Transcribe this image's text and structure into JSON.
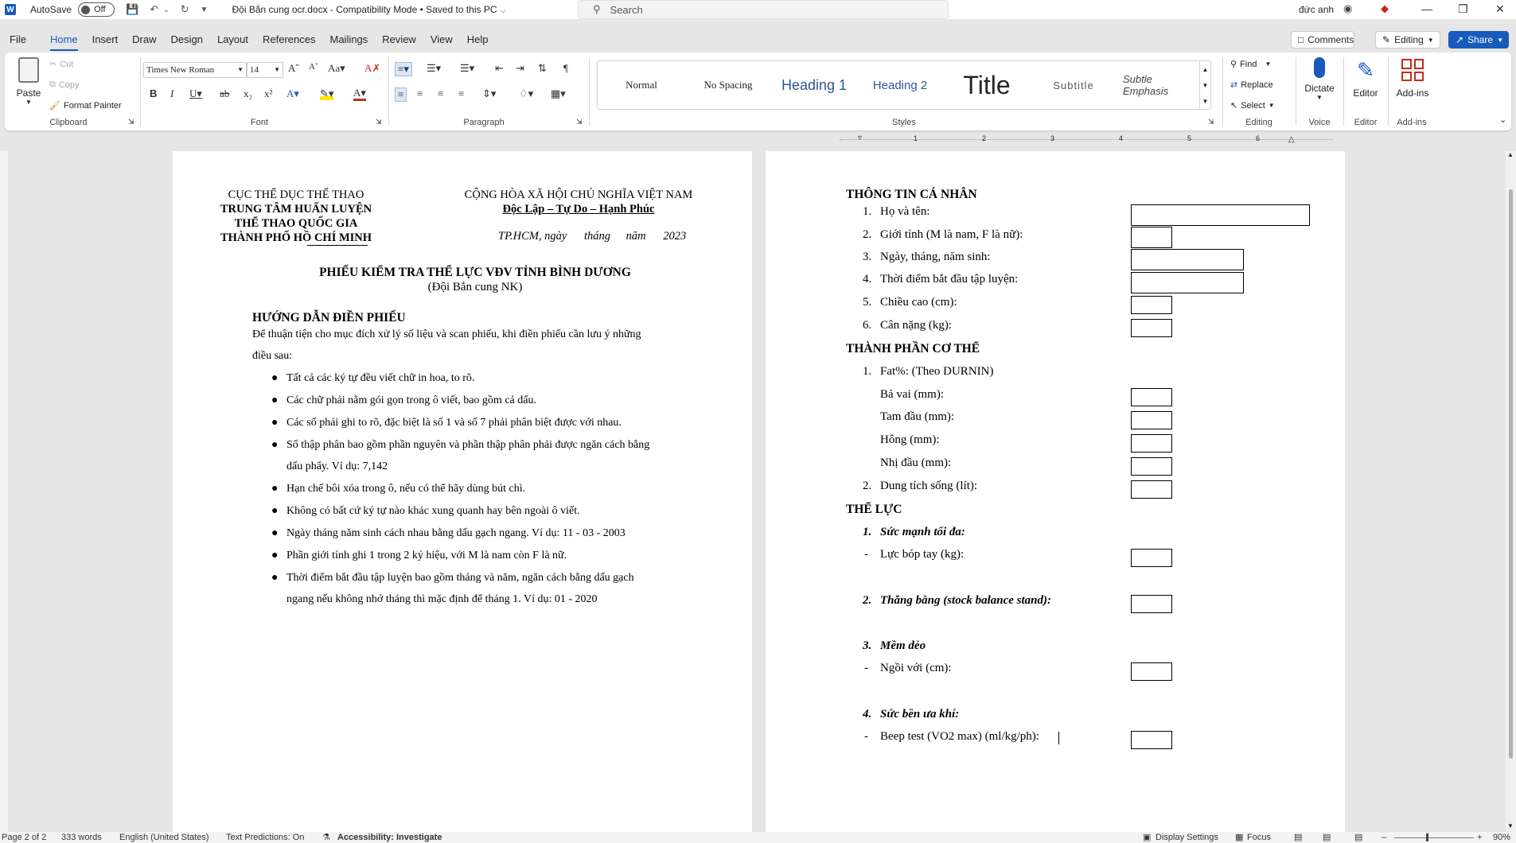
{
  "titlebar": {
    "autosave_label": "AutoSave",
    "autosave_state": "Off",
    "document_title": "Đội Bắn cung ocr.docx  -  Compatibility Mode  •  Saved to this PC",
    "search_placeholder": "Search",
    "user_name": "đức anh"
  },
  "menu": {
    "tabs": [
      "File",
      "Home",
      "Insert",
      "Draw",
      "Design",
      "Layout",
      "References",
      "Mailings",
      "Review",
      "View",
      "Help"
    ],
    "active_tab": "Home",
    "comments_label": "Comments",
    "editing_label": "Editing",
    "share_label": "Share"
  },
  "ribbon": {
    "clipboard": {
      "paste": "Paste",
      "cut": "Cut",
      "copy": "Copy",
      "format_painter": "Format Painter",
      "label": "Clipboard"
    },
    "font": {
      "family": "Times New Roman",
      "size": "14",
      "label": "Font"
    },
    "paragraph": {
      "label": "Paragraph"
    },
    "styles": {
      "label": "Styles",
      "items": [
        "Normal",
        "No Spacing",
        "Heading 1",
        "Heading 2",
        "Title",
        "Subtitle",
        "Subtle Emphasis"
      ]
    },
    "editing": {
      "find": "Find",
      "replace": "Replace",
      "select": "Select",
      "label": "Editing"
    },
    "voice": {
      "dictate": "Dictate",
      "label": "Voice"
    },
    "editor": {
      "editor": "Editor",
      "label": "Editor"
    },
    "addins": {
      "addins": "Add-ins",
      "label": "Add-ins"
    }
  },
  "ruler": {
    "ticks": [
      "1",
      "2",
      "3",
      "4",
      "5",
      "6"
    ]
  },
  "page1": {
    "header_left": [
      "CỤC THỂ DỤC THỂ THAO",
      "TRUNG TÂM HUẤN LUYỆN",
      "THỂ THAO QUỐC GIA",
      "THÀNH PHỐ HỒ CHÍ MINH"
    ],
    "header_right": [
      "CỘNG HÒA XÃ HỘI CHỦ NGHĨA VIỆT NAM",
      "Độc Lập – Tự Do – Hạnh Phúc"
    ],
    "date_line": [
      "TP.HCM, ngày",
      "tháng",
      "năm",
      "2023"
    ],
    "title": "PHIẾU KIỂM TRA THỂ LỰC VĐV TỈNH BÌNH DƯƠNG",
    "subtitle": "(Đội Bắn cung NK)",
    "guide_heading": "HƯỚNG DẪN ĐIỀN PHIẾU",
    "guide_intro_1": "Để thuận tiện cho mục đích xử lý số liệu và scan phiếu, khi điền phiếu cần lưu ý những",
    "guide_intro_2": "điều sau:",
    "bullets": [
      "Tất cả các ký tự đều viết chữ in hoa, to rõ.",
      "Các chữ phải nằm gói gọn trong ô viết, bao gồm cả dấu.",
      "Các số phải ghi to rõ, đặc biệt là số 1 và số 7 phải phân biệt được với nhau.",
      "Số thập phân bao gồm phần nguyên và phần thập phân phải được ngăn cách bằng",
      "dấu phẩy. Ví dụ: 7,142",
      "Hạn chế bôi xóa trong ô, nếu có thể hãy dùng bút chì.",
      "Không có bất cứ ký tự nào khác xung quanh hay bên ngoài ô viết.",
      "Ngày tháng năm sinh cách nhau bằng dấu gạch ngang. Ví dụ: 11 - 03 - 2003",
      "Phần giới tính ghi 1 trong 2 ký hiệu, với M là nam còn F là nữ.",
      "Thời điểm bắt đầu tập luyện bao gồm tháng và năm, ngăn cách bằng dấu gạch",
      "ngang nếu không nhớ tháng thì mặc định để tháng 1. Ví dụ: 01 - 2020"
    ]
  },
  "page2": {
    "sec1_heading": "THÔNG TIN CÁ NHÂN",
    "sec1_items": [
      {
        "num": "1.",
        "text": "Họ và tên:"
      },
      {
        "num": "2.",
        "text": "Giới tính (M là nam, F là nữ):"
      },
      {
        "num": "3.",
        "text": "Ngày, tháng, năm sinh:"
      },
      {
        "num": "4.",
        "text": "Thời điểm bắt đầu tập luyện:"
      },
      {
        "num": "5.",
        "text": "Chiều cao (cm):"
      },
      {
        "num": "6.",
        "text": "Cân nặng (kg):"
      }
    ],
    "sec2_heading": "THÀNH PHẦN CƠ THỂ",
    "sec2_item1": {
      "num": "1.",
      "text": "Fat%: (Theo DURNIN)"
    },
    "sec2_sub": [
      "Bả vai (mm):",
      "Tam đầu (mm):",
      "Hông (mm):",
      "Nhị đầu (mm):"
    ],
    "sec2_item2": {
      "num": "2.",
      "text": "Dung tích sống (lít):"
    },
    "sec3_heading": "THỂ LỰC",
    "sec3_items": [
      {
        "num": "1.",
        "title": "Sức mạnh tối đa:"
      },
      {
        "num": "2.",
        "title": "Thăng bằng (stock balance stand):"
      },
      {
        "num": "3.",
        "title": "Mềm dẻo"
      },
      {
        "num": "4.",
        "title": "Sức bền ưa khí:"
      }
    ],
    "dash": "-",
    "sec3_sub": [
      "Lực bóp tay (kg):",
      "Ngồi với (cm):",
      "Beep test (VO2 max) (ml/kg/ph):"
    ]
  },
  "statusbar": {
    "page": "Page 2 of 2",
    "words": "333 words",
    "language": "English (United States)",
    "predictions": "Text Predictions: On",
    "accessibility": "Accessibility: Investigate",
    "display_settings": "Display Settings",
    "focus": "Focus",
    "zoom": "90%"
  }
}
